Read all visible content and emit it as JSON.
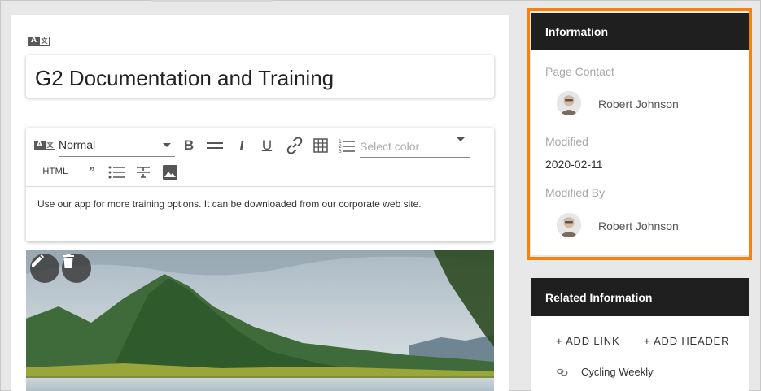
{
  "main": {
    "translate_icon": "translate-icon",
    "title": "G2 Documentation and Training",
    "toolbar": {
      "format_value": "Normal",
      "bold_label": "B",
      "italic_label": "I",
      "underline_label": "U",
      "color_placeholder": "Select color",
      "html_label": "HTML",
      "quote_label": "”",
      "icons": [
        "horizontal-rule-icon",
        "link-icon",
        "table-icon",
        "ordered-list-icon",
        "unordered-list-icon",
        "strikethrough-icon",
        "image-icon"
      ]
    },
    "body_text": "Use our app for more training options. It can be downloaded from our corporate web site.",
    "image": {
      "edit_icon": "pencil-icon",
      "delete_icon": "trash-icon"
    }
  },
  "information": {
    "title": "Information",
    "page_contact_label": "Page Contact",
    "page_contact_name": "Robert Johnson",
    "modified_label": "Modified",
    "modified_value": "2020-02-11",
    "modified_by_label": "Modified By",
    "modified_by_name": "Robert Johnson",
    "highlight_color": "#f5820f"
  },
  "related": {
    "title": "Related Information",
    "add_link_label": "+ ADD LINK",
    "add_header_label": "+ ADD HEADER",
    "items": [
      {
        "label": "Cycling Weekly",
        "icon": "link-icon"
      }
    ]
  }
}
